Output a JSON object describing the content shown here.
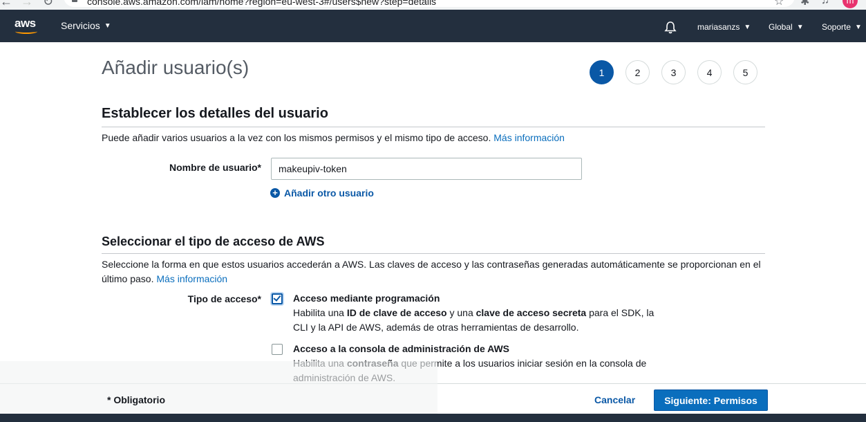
{
  "browser": {
    "url": "console.aws.amazon.com/iam/home?region=eu-west-3#/users$new?step=details",
    "profile_initial": "m"
  },
  "nav": {
    "logo": "aws",
    "services_label": "Servicios",
    "user_label": "mariasanzs",
    "region_label": "Global",
    "support_label": "Soporte",
    "caret": "▼"
  },
  "page": {
    "title": "Añadir usuario(s)",
    "steps": [
      "1",
      "2",
      "3",
      "4",
      "5"
    ],
    "active_step": 1
  },
  "details": {
    "section_title": "Establecer los detalles del usuario",
    "description": "Puede añadir varios usuarios a la vez con los mismos permisos y el mismo tipo de acceso.",
    "more_info": "Más información",
    "username_label": "Nombre de usuario*",
    "username_value": "makeupiv-token",
    "add_user_label": "Añadir otro usuario"
  },
  "access": {
    "section_title": "Seleccionar el tipo de acceso de AWS",
    "description": "Seleccione la forma en que estos usuarios accederán a AWS. Las claves de acceso y las contraseñas generadas automáticamente se proporcionan en el último paso.",
    "more_info": "Más información",
    "type_label": "Tipo de acceso*",
    "options": [
      {
        "title": "Acceso mediante programación",
        "checked": true,
        "desc_pre": "Habilita una ",
        "desc_b1": "ID de clave de acceso",
        "desc_mid": " y una ",
        "desc_b2": "clave de acceso secreta",
        "desc_post": " para el SDK, la CLI y la API de AWS, además de otras herramientas de desarrollo."
      },
      {
        "title": "Acceso a la consola de administración de AWS",
        "checked": false,
        "desc_pre": "Habilita una ",
        "desc_b1": "contraseña",
        "desc_post": " que permite a los usuarios iniciar sesión en la consola de administración de AWS."
      }
    ]
  },
  "footer": {
    "required_note": "* Obligatorio",
    "cancel_label": "Cancelar",
    "next_label": "Siguiente: Permisos"
  },
  "colors": {
    "nav_bg": "#232f3e",
    "primary": "#0a6ebd",
    "link": "#0a6ebd",
    "active_step": "#0a58a6"
  }
}
